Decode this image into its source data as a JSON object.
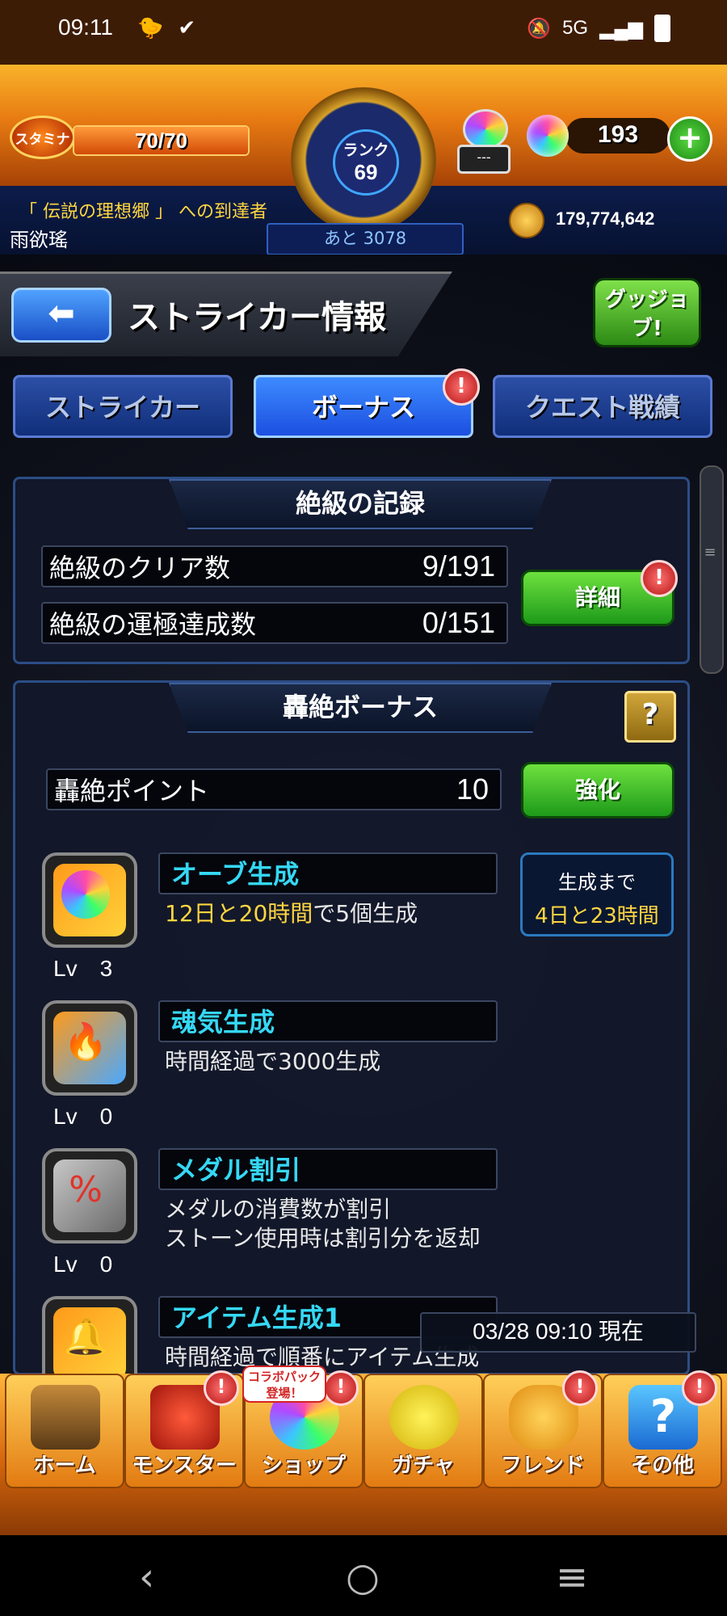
{
  "statusbar": {
    "time": "09:11",
    "network": "5G"
  },
  "header": {
    "stamina_label": "スタミナ",
    "stamina_text": "70/70",
    "stamina_fraction": 1.0,
    "rank_label": "ランク",
    "rank_value": "69",
    "rank_next": "あと 3078",
    "potion_label": "---",
    "orb_count": "193",
    "plus_label": "+",
    "title_line": "「 伝説の理想郷 」 への到達者",
    "player_name": "雨欲瑤",
    "coin_count": "179,774,642"
  },
  "page": {
    "back_label": "⬅",
    "title": "ストライカー情報",
    "good_job": "グッジョブ!"
  },
  "tabs": [
    {
      "label": "ストライカー"
    },
    {
      "label": "ボーナス"
    },
    {
      "label": "クエスト戦績"
    }
  ],
  "alert_symbol": "!",
  "records": {
    "title": "絶級の記録",
    "rows": [
      {
        "label": "絶級のクリア数",
        "value": "9/191"
      },
      {
        "label": "絶級の運極達成数",
        "value": "0/151"
      }
    ],
    "detail_button": "詳細"
  },
  "bonus": {
    "title": "轟絶ボーナス",
    "help": "?",
    "points_label": "轟絶ポイント",
    "points_value": "10",
    "upgrade_button": "強化",
    "generate_box": {
      "line1": "生成まで",
      "line2": "4日と23時間"
    },
    "items": [
      {
        "name": "オーブ生成",
        "desc_highlight": "12日と20時間",
        "desc_rest": "で5個生成",
        "level": "Lv　3",
        "icon": "orb-generate-icon"
      },
      {
        "name": "魂気生成",
        "desc_highlight": "",
        "desc_rest": "時間経過で3000生成",
        "level": "Lv　0",
        "icon": "soul-generate-icon"
      },
      {
        "name": "メダル割引",
        "desc_highlight": "",
        "desc_rest": "メダルの消費数が割引\nストーン使用時は割引分を返却",
        "level": "Lv　0",
        "icon": "medal-discount-icon"
      },
      {
        "name": "アイテム生成1",
        "desc_highlight": "",
        "desc_rest": "時間経過で順番にアイテム生成",
        "level": "",
        "icon": "item-generate-icon"
      }
    ]
  },
  "timestamp": "03/28 09:10 現在",
  "bottom_nav": {
    "collab_tag": "コラボパック\n登場！",
    "items": [
      {
        "label": "ホーム",
        "icon": "home-icon",
        "alert": false
      },
      {
        "label": "モンスター",
        "icon": "monster-icon",
        "alert": true
      },
      {
        "label": "ショップ",
        "icon": "shop-icon",
        "alert": true
      },
      {
        "label": "ガチャ",
        "icon": "gacha-icon",
        "alert": false
      },
      {
        "label": "フレンド",
        "icon": "friend-icon",
        "alert": true
      },
      {
        "label": "その他",
        "icon": "other-icon",
        "alert": true
      }
    ]
  },
  "colors": {
    "accent_cyan": "#35d8f5",
    "highlight_yellow": "#ffd640",
    "button_green": "#2fb820",
    "tab_blue": "#1c4fe0"
  }
}
